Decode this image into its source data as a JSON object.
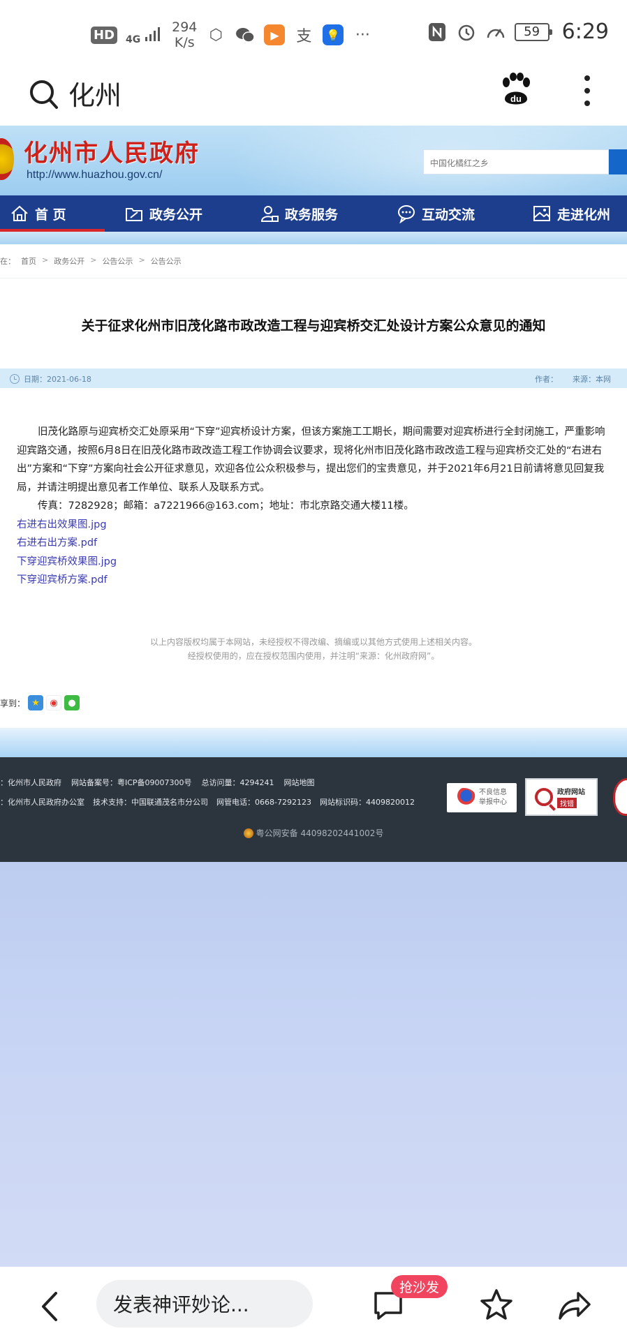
{
  "status_bar": {
    "hd": "HD",
    "network": "4G",
    "speed_value": "294",
    "speed_unit": "K/s",
    "battery": "59",
    "time": "6:29"
  },
  "browser": {
    "query": "化州",
    "comment_placeholder": "发表神评妙论...",
    "sofa_badge": "抢沙发"
  },
  "site": {
    "name": "化州市人民政府",
    "url": "http://www.huazhou.gov.cn/",
    "search_placeholder": "中国化橘红之乡",
    "nav": [
      {
        "label": "首 页",
        "icon": "home-icon"
      },
      {
        "label": "政务公开",
        "icon": "folder-icon"
      },
      {
        "label": "政务服务",
        "icon": "user-service-icon"
      },
      {
        "label": "互动交流",
        "icon": "chat-icon"
      },
      {
        "label": "走进化州",
        "icon": "picture-icon"
      }
    ]
  },
  "breadcrumb": {
    "prefix": "在：",
    "items": [
      "首页",
      "政务公开",
      "公告公示",
      "公告公示"
    ]
  },
  "article": {
    "title": "关于征求化州市旧茂化路市政改造工程与迎宾桥交汇处设计方案公众意见的通知",
    "date": "日期：2021-06-18",
    "author": "作者：",
    "source": "来源：本网",
    "paragraph": "旧茂化路原与迎宾桥交汇处原采用“下穿”迎宾桥设计方案，但该方案施工工期长，期间需要对迎宾桥进行全封闭施工，严重影响迎宾路交通，按照6月8日在旧茂化路市政改造工程工作协调会议要求，现将化州市旧茂化路市政改造工程与迎宾桥交汇处的“右进右出”方案和“下穿”方案向社会公开征求意见，欢迎各位公众积极参与，提出您们的宝贵意见，并于2021年6月21日前请将意见回复我局，并请注明提出意见者工作单位、联系人及联系方式。",
    "contact": "传真：7282928；邮箱：a7221966@163.com；地址：市北京路交通大楼11楼。",
    "attachments": [
      "右进右出效果图.jpg",
      "右进右出方案.pdf",
      "下穿迎宾桥效果图.jpg",
      "下穿迎宾桥方案.pdf"
    ],
    "copyright_1": "以上内容版权均属于本网站，未经授权不得改编、摘编或以其他方式使用上述相关内容。",
    "copyright_2": "经授权使用的，应在授权范围内使用，并注明“来源：化州政府网”。",
    "share_label": "享到："
  },
  "footer": {
    "line1": [
      "：化州市人民政府",
      "网站备案号：粤ICP备09007300号",
      "总访问量：4294241",
      "网站地图"
    ],
    "line2": [
      "：化州市人民政府办公室",
      "技术支持：中国联通茂名市分公司",
      "网管电话：0668-7292123",
      "网站标识码：4409820012"
    ],
    "police": "粤公网安备 44098202441002号",
    "badge_report_1": "不良信息",
    "badge_report_2": "举报中心",
    "badge_fix_1": "政府网站",
    "badge_fix_2": "找错"
  }
}
